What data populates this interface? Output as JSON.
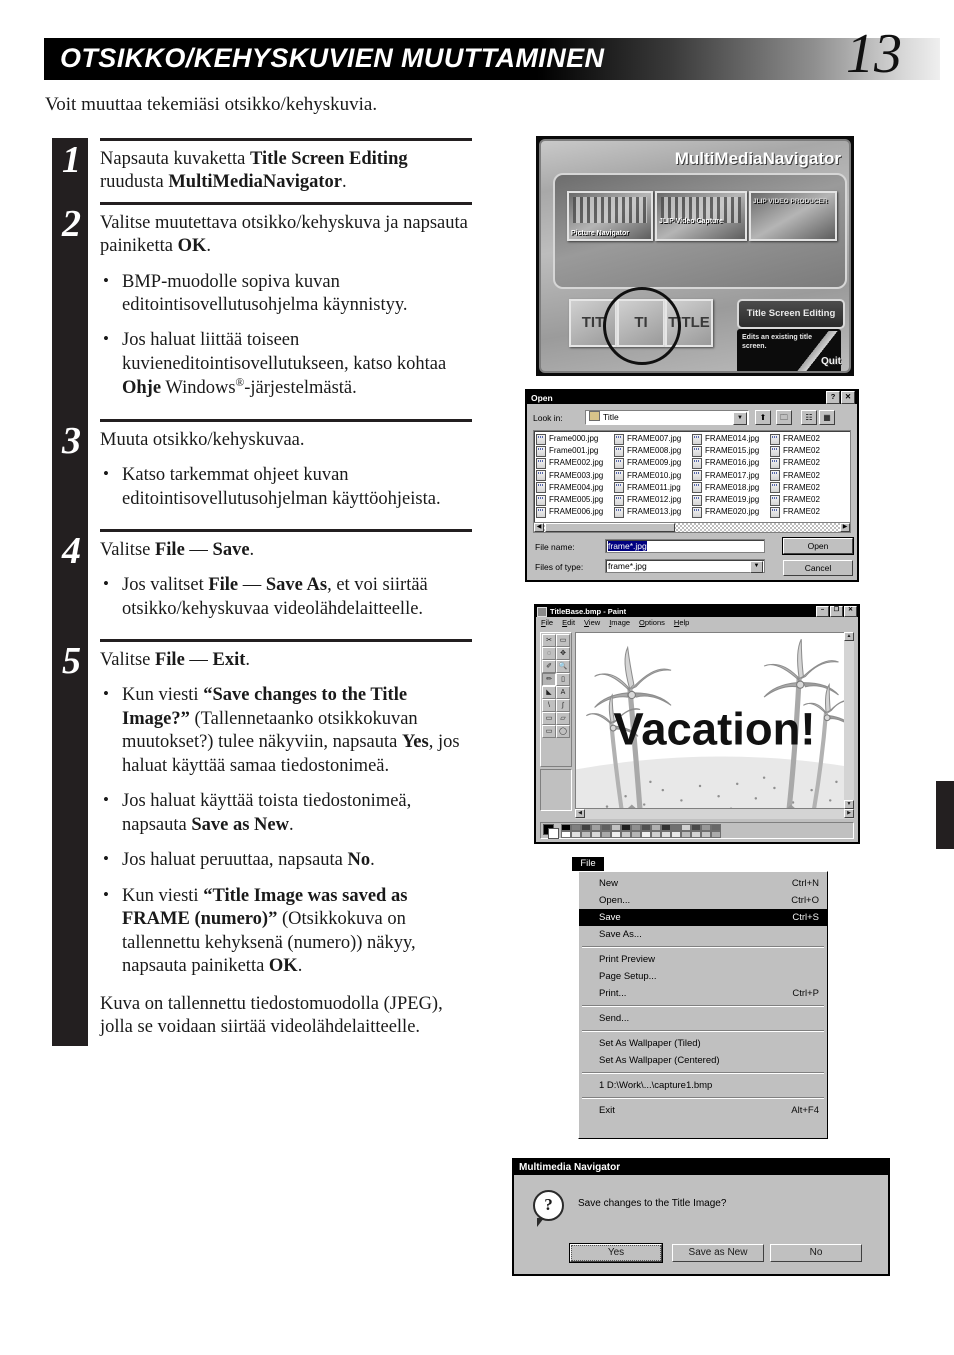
{
  "header": {
    "title": "OTSIKKO/KEHYSKUVIEN MUUTTAMINEN",
    "page_number": "13",
    "intro": "Voit muuttaa tekemiäsi otsikko/kehyskuvia."
  },
  "steps": [
    {
      "number": "1",
      "text_html": "Napsauta kuvaketta <b>Title Screen Editing</b> ruudusta <b>MultiMediaNavigator</b>.",
      "bullets": []
    },
    {
      "number": "2",
      "text_html": "Valitse muutettava otsikko/kehyskuva ja napsauta painiketta <b>OK</b>.",
      "bullets": [
        "BMP-muodolle sopiva kuvan editointisovellutusohjelma käynnistyy.",
        "Jos haluat liittää toiseen kuvieneditointisovellutukseen, katso kohtaa <b>Ohje</b> Windows<sup>®</sup>-järjestelmästä."
      ]
    },
    {
      "number": "3",
      "text_html": "Muuta otsikko/kehyskuvaa.",
      "bullets": [
        "Katso tarkemmat ohjeet kuvan editointisovellutusohjelman käyttöohjeista."
      ]
    },
    {
      "number": "4",
      "text_html": "Valitse <b>File</b> — <b>Save</b>.",
      "bullets": [
        "Jos valitset <b>File</b> — <b>Save As</b>, et voi siirtää otsikko/kehyskuvaa videolähdelaitteelle."
      ]
    },
    {
      "number": "5",
      "text_html": "Valitse <b>File</b> — <b>Exit</b>.",
      "bullets": [
        "Kun viesti <b>“Save changes to the Title Image?”</b> (Tallennetaanko otsikkokuvan muutokset?) tulee näkyviin, napsauta <b>Yes</b>, jos haluat käyttää samaa tiedostonimeä.",
        "Jos haluat käyttää toista tiedostonimeä, napsauta <b>Save as New</b>.",
        "Jos haluat peruuttaa, napsauta <b>No</b>.",
        "Kun viesti <b>“Title Image was saved as FRAME (numero)”</b> (Otsikkokuva on tallennettu kehyksenä (numero)) näkyy, napsauta painiketta <b>OK</b>."
      ],
      "tail": "Kuva on tallennettu tiedostomuodolla (JPEG), jolla se voidaan siirtää videolähdelaitteelle."
    }
  ],
  "mmn": {
    "title": "MultiMediaNavigator",
    "apps": [
      {
        "label": "Picture Navigator"
      },
      {
        "label": "JLIP Video Capture"
      },
      {
        "label": "JLIP VIDEO PRODUCER"
      }
    ],
    "title_icons": [
      "TIT",
      "TI",
      "TITLE"
    ],
    "title_screen_editing": "Title Screen Editing",
    "description": "Edits an existing title screen.",
    "quit": "Quit"
  },
  "open_dialog": {
    "title": "Open",
    "help_btn": "?",
    "close_btn": "✕",
    "lookin_label": "Look in:",
    "lookin_value": "Title",
    "toolbar_icons": [
      "up-one-level-icon",
      "new-folder-icon",
      "list-view-icon",
      "details-view-icon"
    ],
    "file_columns": [
      [
        "Frame000.jpg",
        "Frame001.jpg",
        "FRAME002.jpg",
        "FRAME003.jpg",
        "FRAME004.jpg",
        "FRAME005.jpg",
        "FRAME006.jpg"
      ],
      [
        "FRAME007.jpg",
        "FRAME008.jpg",
        "FRAME009.jpg",
        "FRAME010.jpg",
        "FRAME011.jpg",
        "FRAME012.jpg",
        "FRAME013.jpg"
      ],
      [
        "FRAME014.jpg",
        "FRAME015.jpg",
        "FRAME016.jpg",
        "FRAME017.jpg",
        "FRAME018.jpg",
        "FRAME019.jpg",
        "FRAME020.jpg"
      ],
      [
        "FRAME02",
        "FRAME02",
        "FRAME02",
        "FRAME02",
        "FRAME02",
        "FRAME02",
        "FRAME02"
      ]
    ],
    "filename_label": "File name:",
    "filename_value": "frame*.jpg",
    "filetype_label": "Files of type:",
    "filetype_value": "frame*.jpg",
    "open_button": "Open",
    "cancel_button": "Cancel"
  },
  "paint": {
    "title": "TitleBase.bmp - Paint",
    "window_buttons": [
      "–",
      "❐",
      "✕"
    ],
    "menus": [
      "File",
      "Edit",
      "View",
      "Image",
      "Options",
      "Help"
    ],
    "tools": [
      "✂",
      "▭",
      "◌",
      "✥",
      "✐",
      "🔍",
      "✏",
      "▯",
      "◣",
      "A",
      "\\",
      "∫",
      "▭",
      "▱",
      "▭",
      "◯"
    ],
    "canvas_text": "Vacation!"
  },
  "file_menu": {
    "button": "File",
    "items": [
      {
        "label": "New",
        "accel": "Ctrl+N",
        "selected": false,
        "sep_after": false
      },
      {
        "label": "Open...",
        "accel": "Ctrl+O",
        "selected": false,
        "sep_after": false
      },
      {
        "label": "Save",
        "accel": "Ctrl+S",
        "selected": true,
        "sep_after": false
      },
      {
        "label": "Save As...",
        "accel": "",
        "selected": false,
        "sep_after": true
      },
      {
        "label": "Print Preview",
        "accel": "",
        "selected": false,
        "sep_after": false
      },
      {
        "label": "Page Setup...",
        "accel": "",
        "selected": false,
        "sep_after": false
      },
      {
        "label": "Print...",
        "accel": "Ctrl+P",
        "selected": false,
        "sep_after": true
      },
      {
        "label": "Send...",
        "accel": "",
        "selected": false,
        "sep_after": true
      },
      {
        "label": "Set As Wallpaper (Tiled)",
        "accel": "",
        "selected": false,
        "sep_after": false
      },
      {
        "label": "Set As Wallpaper (Centered)",
        "accel": "",
        "selected": false,
        "sep_after": true
      },
      {
        "label": "1 D:\\Work\\...\\capture1.bmp",
        "accel": "",
        "selected": false,
        "sep_after": true
      },
      {
        "label": "Exit",
        "accel": "Alt+F4",
        "selected": false,
        "sep_after": false
      }
    ]
  },
  "msgbox": {
    "title": "Multimedia Navigator",
    "icon": "?",
    "message": "Save changes to the Title Image?",
    "buttons": [
      "Yes",
      "Save as New",
      "No"
    ]
  }
}
